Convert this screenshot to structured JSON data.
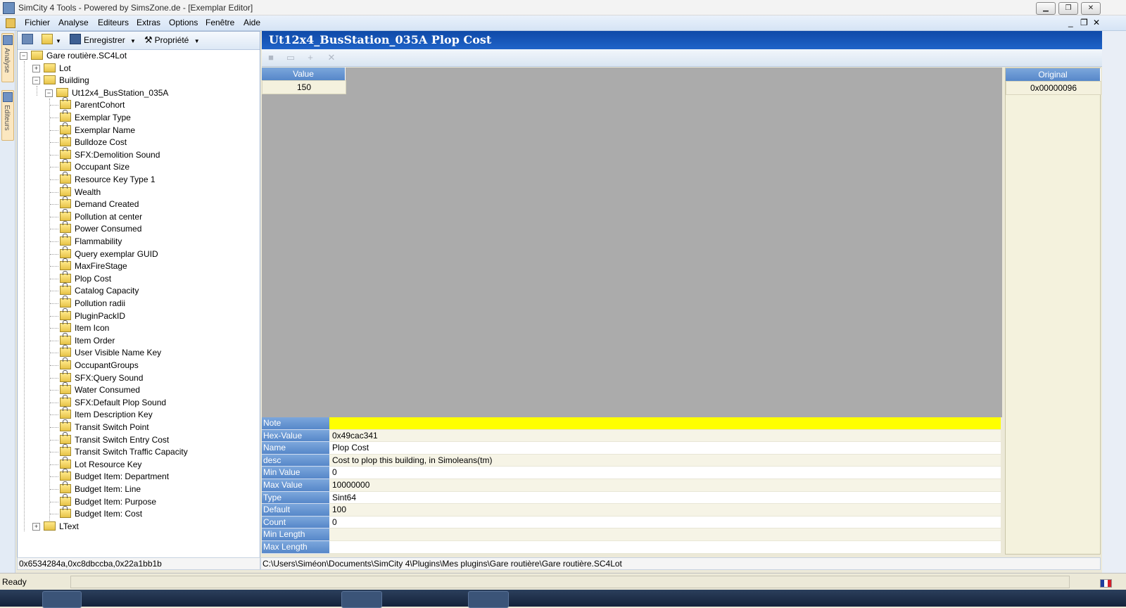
{
  "window": {
    "title": "SimCity 4 Tools - Powered by SimsZone.de - [Exemplar Editor]",
    "minimize": "▁",
    "maximize": "❐",
    "close": "✕"
  },
  "menu": {
    "items": [
      "Fichier",
      "Analyse",
      "Editeurs",
      "Extras",
      "Options",
      "Fenêtre",
      "Aide"
    ],
    "mdi_min": "_",
    "mdi_restore": "❐",
    "mdi_close": "✕"
  },
  "side_tabs": [
    "Analyse",
    "Editeurs"
  ],
  "left_toolbar": {
    "save_label": "Enregistrer",
    "property_label": "Propriété"
  },
  "tree": {
    "root": "Gare routière.SC4Lot",
    "lot": "Lot",
    "building": "Building",
    "exemplar": "Ut12x4_BusStation_035A",
    "properties": [
      "ParentCohort",
      "Exemplar Type",
      "Exemplar Name",
      "Bulldoze Cost",
      "SFX:Demolition Sound",
      "Occupant Size",
      "Resource Key Type 1",
      "Wealth",
      "Demand Created",
      "Pollution at center",
      "Power Consumed",
      "Flammability",
      "Query exemplar GUID",
      "MaxFireStage",
      "Plop Cost",
      "Catalog Capacity",
      "Pollution radii",
      "PluginPackID",
      "Item Icon",
      "Item Order",
      "User Visible Name Key",
      "OccupantGroups",
      "SFX:Query Sound",
      "Water Consumed",
      "SFX:Default Plop Sound",
      "Item Description Key",
      "Transit Switch Point",
      "Transit Switch Entry Cost",
      "Transit Switch Traffic Capacity",
      "Lot Resource Key",
      "Budget Item: Department",
      "Budget Item: Line",
      "Budget Item: Purpose",
      "Budget Item: Cost"
    ],
    "ltext": "LText"
  },
  "left_status": "0x6534284a,0xc8dbccba,0x22a1bb1b",
  "main": {
    "title": "Ut12x4_BusStation_035A Plop Cost",
    "value_header": "Value",
    "value": "150",
    "original_header": "Original",
    "original_value": "0x00000096"
  },
  "props": [
    {
      "key": "Note",
      "value": ""
    },
    {
      "key": "Hex-Value",
      "value": "0x49cac341"
    },
    {
      "key": "Name",
      "value": "Plop Cost"
    },
    {
      "key": "desc",
      "value": "Cost to plop this building, in Simoleans(tm)"
    },
    {
      "key": "Min Value",
      "value": "0"
    },
    {
      "key": "Max Value",
      "value": "10000000"
    },
    {
      "key": "Type",
      "value": "Sint64"
    },
    {
      "key": "Default",
      "value": "100"
    },
    {
      "key": "Count",
      "value": "0"
    },
    {
      "key": "Min Length",
      "value": ""
    },
    {
      "key": "Max Length",
      "value": ""
    }
  ],
  "path": "C:\\Users\\Siméon\\Documents\\SimCity 4\\Plugins\\Mes plugins\\Gare routière\\Gare routière.SC4Lot",
  "status": "Ready",
  "colors": {
    "header_blue": "#1f63c8",
    "key_blue": "#5687c9",
    "note_highlight": "#ffff00",
    "grid_gray": "#ababab"
  }
}
